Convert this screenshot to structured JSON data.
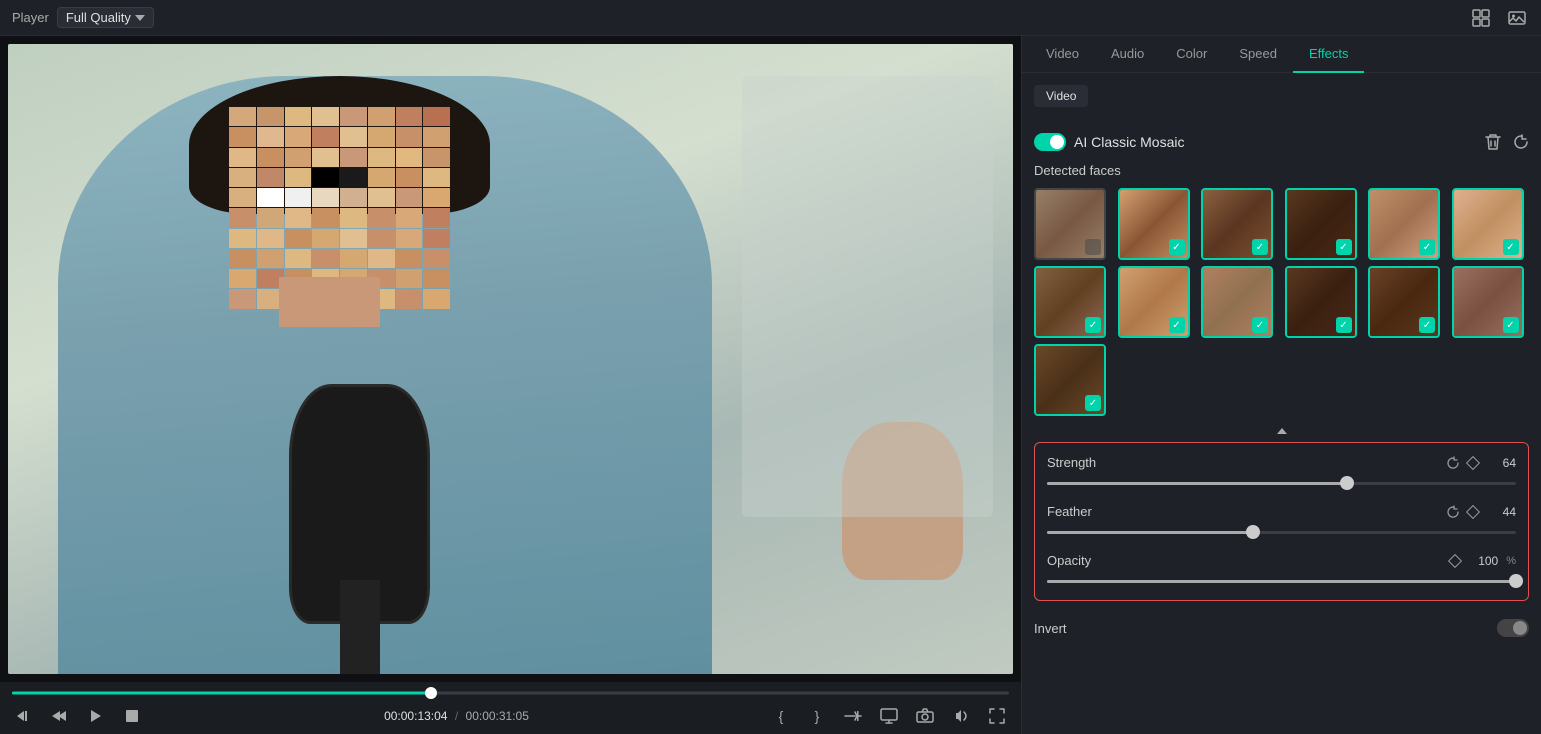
{
  "topbar": {
    "player_label": "Player",
    "quality_label": "Full Quality",
    "grid_icon": "grid-icon",
    "image_icon": "image-icon"
  },
  "tabs": [
    {
      "id": "video",
      "label": "Video"
    },
    {
      "id": "audio",
      "label": "Audio"
    },
    {
      "id": "color",
      "label": "Color"
    },
    {
      "id": "speed",
      "label": "Speed"
    },
    {
      "id": "effects",
      "label": "Effects",
      "active": true
    }
  ],
  "effects_panel": {
    "video_subtab": "Video",
    "effect_name": "AI Classic Mosaic",
    "detected_faces_label": "Detected faces",
    "faces": [
      {
        "id": 1,
        "selected": false,
        "skin": "face-1"
      },
      {
        "id": 2,
        "selected": true,
        "skin": "face-2"
      },
      {
        "id": 3,
        "selected": true,
        "skin": "face-3"
      },
      {
        "id": 4,
        "selected": true,
        "skin": "face-4"
      },
      {
        "id": 5,
        "selected": true,
        "skin": "face-5"
      },
      {
        "id": 6,
        "selected": true,
        "skin": "face-6"
      },
      {
        "id": 7,
        "selected": true,
        "skin": "face-7"
      },
      {
        "id": 8,
        "selected": true,
        "skin": "face-8"
      },
      {
        "id": 9,
        "selected": true,
        "skin": "face-9"
      },
      {
        "id": 10,
        "selected": true,
        "skin": "face-10"
      },
      {
        "id": 11,
        "selected": true,
        "skin": "face-11"
      },
      {
        "id": 12,
        "selected": true,
        "skin": "face-12"
      },
      {
        "id": 13,
        "selected": true,
        "skin": "face-13"
      }
    ],
    "sliders": {
      "strength": {
        "label": "Strength",
        "value": 64,
        "min": 0,
        "max": 100,
        "percent": 64
      },
      "feather": {
        "label": "Feather",
        "value": 44,
        "min": 0,
        "max": 100,
        "percent": 44
      },
      "opacity": {
        "label": "Opacity",
        "value": 100,
        "unit": "%",
        "min": 0,
        "max": 100,
        "percent": 100
      }
    },
    "invert_label": "Invert",
    "invert_enabled": false
  },
  "timeline": {
    "current_time": "00:00:13:04",
    "total_time": "00:00:31:05",
    "progress_percent": 42,
    "separator": "/",
    "controls": {
      "rewind": "⏮",
      "step_back": "⏪",
      "play": "▶",
      "stop": "■"
    }
  }
}
